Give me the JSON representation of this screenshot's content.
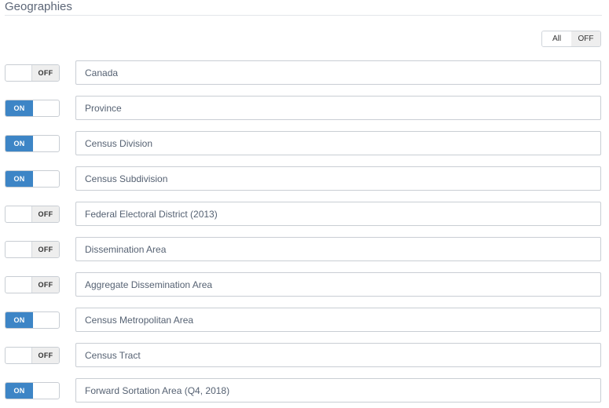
{
  "section": {
    "title": "Geographies"
  },
  "all_toggle": {
    "all_label": "All",
    "off_label": "OFF"
  },
  "rows": [
    {
      "label": "Canada",
      "state": "OFF"
    },
    {
      "label": "Province",
      "state": "ON"
    },
    {
      "label": "Census Division",
      "state": "ON"
    },
    {
      "label": "Census Subdivision",
      "state": "ON"
    },
    {
      "label": "Federal Electoral District (2013)",
      "state": "OFF"
    },
    {
      "label": "Dissemination Area",
      "state": "OFF"
    },
    {
      "label": "Aggregate Dissemination Area",
      "state": "OFF"
    },
    {
      "label": "Census Metropolitan Area",
      "state": "ON"
    },
    {
      "label": "Census Tract",
      "state": "OFF"
    },
    {
      "label": "Forward Sortation Area (Q4, 2018)",
      "state": "ON"
    }
  ],
  "colors": {
    "on": "#3d85c6",
    "off_bg": "#eeeeee"
  }
}
